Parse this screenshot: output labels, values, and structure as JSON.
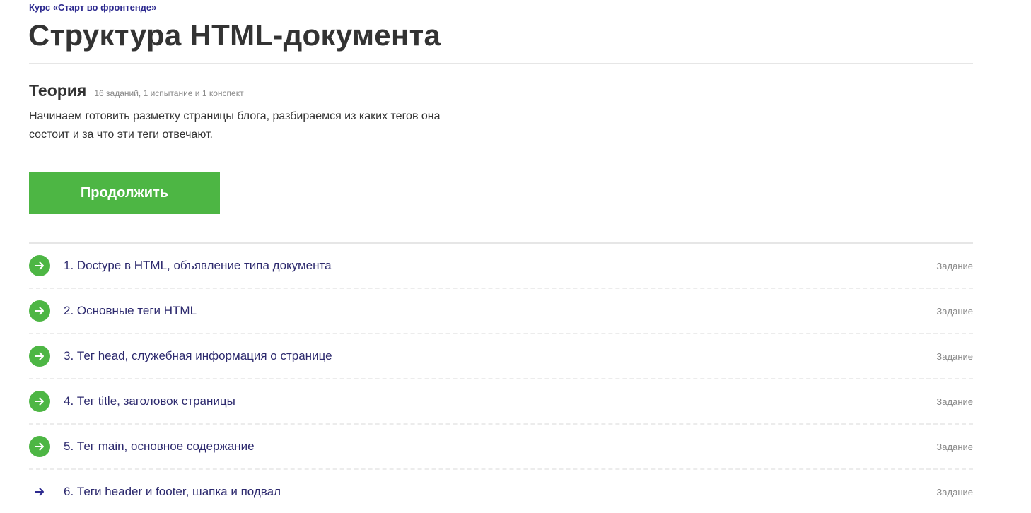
{
  "course_link": "Курс «Старт во фронтенде»",
  "page_title": "Структура HTML-документа",
  "section": {
    "title": "Теория",
    "meta": "16 заданий, 1 испытание и 1 конспект",
    "description": "Начинаем готовить разметку страницы блога, разбираемся из каких тегов она состоит и за что эти теги отвечают."
  },
  "continue_button": "Продолжить",
  "colors": {
    "accent_green": "#4db644",
    "link_purple": "#2d2a8f"
  },
  "tasks": [
    {
      "label": "1. Doctype в HTML, объявление типа документа",
      "type": "Задание",
      "status": "completed",
      "icon": "arrow-right-icon"
    },
    {
      "label": "2. Основные теги HTML",
      "type": "Задание",
      "status": "completed",
      "icon": "arrow-right-icon"
    },
    {
      "label": "3. Тег head, служебная информация о странице",
      "type": "Задание",
      "status": "completed",
      "icon": "arrow-right-icon"
    },
    {
      "label": "4. Тег title, заголовок страницы",
      "type": "Задание",
      "status": "completed",
      "icon": "arrow-right-icon"
    },
    {
      "label": "5. Тег main, основное содержание",
      "type": "Задание",
      "status": "completed",
      "icon": "arrow-right-icon"
    },
    {
      "label": "6. Теги header и footer, шапка и подвал",
      "type": "Задание",
      "status": "next",
      "icon": "arrow-right-icon"
    }
  ]
}
